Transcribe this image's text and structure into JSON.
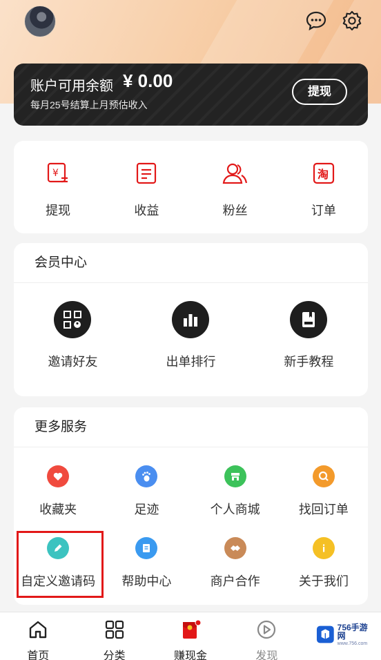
{
  "header": {
    "avatar_icon": "user-avatar",
    "message_icon": "chat-bubble-icon",
    "settings_icon": "gear-icon"
  },
  "balance": {
    "label": "账户可用余额",
    "amount": "¥ 0.00",
    "subtitle": "每月25号结算上月预估收入",
    "withdraw_button": "提现"
  },
  "quick_actions": [
    {
      "label": "提现",
      "icon": "yuan-icon"
    },
    {
      "label": "收益",
      "icon": "document-icon"
    },
    {
      "label": "粉丝",
      "icon": "users-icon"
    },
    {
      "label": "订单",
      "icon": "taobao-icon"
    }
  ],
  "member_center": {
    "title": "会员中心",
    "items": [
      {
        "label": "邀请好友",
        "icon": "qr-code-icon"
      },
      {
        "label": "出单排行",
        "icon": "bar-chart-icon"
      },
      {
        "label": "新手教程",
        "icon": "book-icon"
      }
    ]
  },
  "more_services": {
    "title": "更多服务",
    "items": [
      {
        "label": "收藏夹",
        "icon": "heart-icon",
        "color": "#f04a3e"
      },
      {
        "label": "足迹",
        "icon": "footprint-icon",
        "color": "#4a8ef0"
      },
      {
        "label": "个人商城",
        "icon": "shop-icon",
        "color": "#3cc25a"
      },
      {
        "label": "找回订单",
        "icon": "search-icon",
        "color": "#f39a2b"
      },
      {
        "label": "自定义邀请码",
        "icon": "pencil-icon",
        "color": "#3cc3c0"
      },
      {
        "label": "帮助中心",
        "icon": "doc-icon",
        "color": "#3a9af0"
      },
      {
        "label": "商户合作",
        "icon": "handshake-icon",
        "color": "#c98a58"
      },
      {
        "label": "关于我们",
        "icon": "info-icon",
        "color": "#f5c024"
      }
    ]
  },
  "tabbar": [
    {
      "label": "首页",
      "icon": "home-icon"
    },
    {
      "label": "分类",
      "icon": "grid-icon"
    },
    {
      "label": "赚现金",
      "icon": "red-packet-icon"
    },
    {
      "label": "发现",
      "icon": "play-icon"
    }
  ],
  "watermark": {
    "text": "756手游网",
    "sub": "www.756.com"
  },
  "colors": {
    "accent": "#e21818",
    "dark_card": "#232323",
    "hero": "#f7cca4"
  }
}
